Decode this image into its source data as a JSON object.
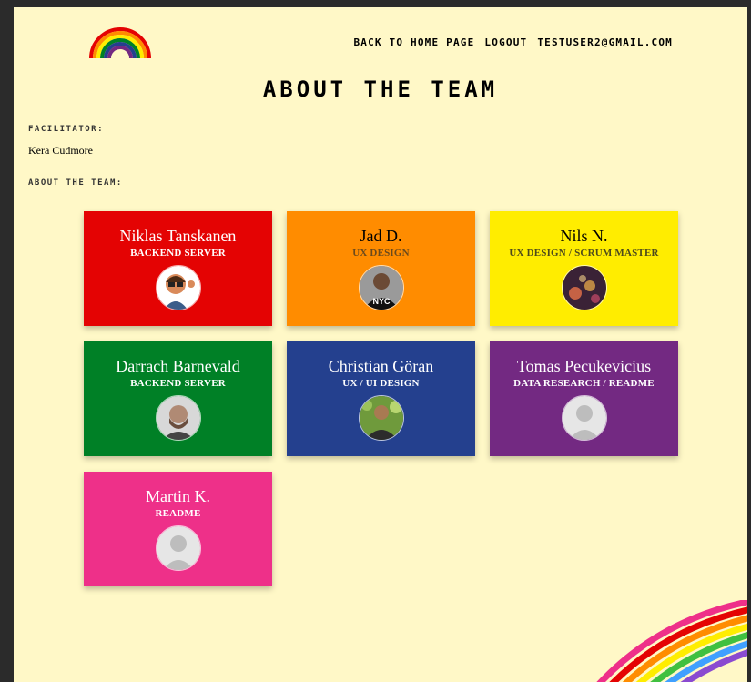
{
  "nav": {
    "home": "Back to Home Page",
    "logout": "Logout",
    "user": "testuser2@gmail.com"
  },
  "page_title": "About the Team",
  "facilitator": {
    "label": "Facilitator:",
    "name": "Kera Cudmore"
  },
  "team_label": "About the team:",
  "members": [
    {
      "name": "Niklas Tanskanen",
      "role": "Backend Server",
      "bg": "#e40303",
      "fg": "#ffffff",
      "avatar": "cartoon-avatar-icon"
    },
    {
      "name": "Jad D.",
      "role": "UX Design",
      "bg": "#ff8c00",
      "fg": "#000000",
      "role_fg": "#6b4a1c",
      "avatar": "photo-avatar-icon"
    },
    {
      "name": "Nils N.",
      "role": "UX Design / Scrum Master",
      "bg": "#ffed00",
      "fg": "#000000",
      "role_fg": "#4d4a1c",
      "avatar": "bokeh-avatar-icon"
    },
    {
      "name": "Darrach Barnevald",
      "role": "Backend Server",
      "bg": "#008026",
      "fg": "#ffffff",
      "avatar": "photo-avatar-icon"
    },
    {
      "name": "Christian Göran",
      "role": "UX / UI Design",
      "bg": "#24408e",
      "fg": "#ffffff",
      "avatar": "photo-avatar-icon"
    },
    {
      "name": "Tomas Pecukevicius",
      "role": "Data Research / Readme",
      "bg": "#732982",
      "fg": "#ffffff",
      "avatar": "default-user-icon"
    },
    {
      "name": "Martin K.",
      "role": "Readme",
      "bg": "#ee3089",
      "fg": "#ffffff",
      "avatar": "default-user-icon"
    }
  ],
  "colors": {
    "background": "#fff8c7",
    "rainbow": [
      "#e40303",
      "#ff8c00",
      "#ffed00",
      "#008026",
      "#24408e",
      "#732982"
    ]
  }
}
